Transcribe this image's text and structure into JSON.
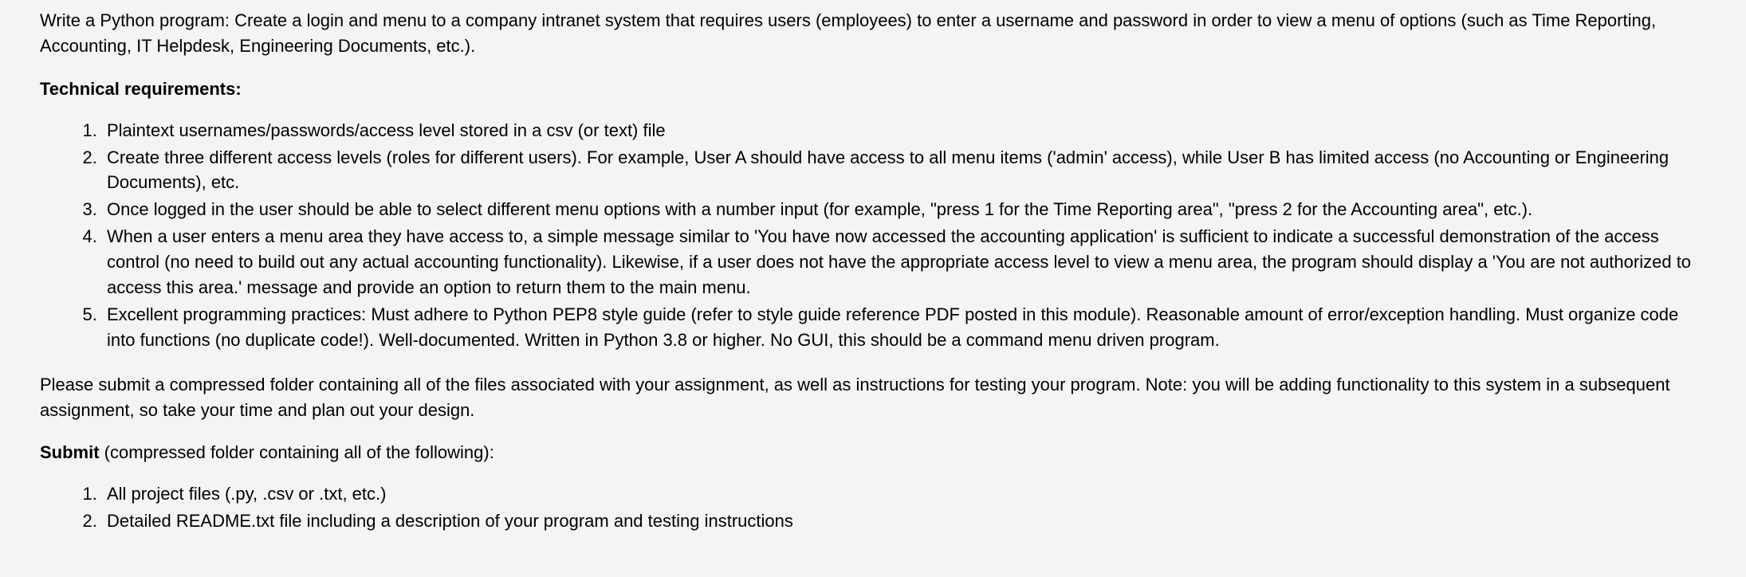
{
  "intro": "Write a Python program: Create a login and menu to a company intranet system that requires users (employees) to enter a username and password in order to view a menu of options (such as Time Reporting, Accounting, IT Helpdesk, Engineering Documents, etc.).",
  "technical_requirements_heading": "Technical requirements:",
  "technical_requirements": [
    "Plaintext usernames/passwords/access level stored in a csv (or text) file",
    "Create three different access levels (roles for different users). For example, User A should have access to all menu items ('admin' access), while User B has limited access (no Accounting or Engineering Documents), etc.",
    "Once logged in the user should be able to select different menu options with a number input (for example, \"press 1 for the Time Reporting area\", \"press 2 for the Accounting area\", etc.).",
    "When a user enters a menu area they have access to, a simple message similar to 'You have now accessed the accounting application' is sufficient to indicate a successful demonstration of the access control (no need to build out any actual accounting functionality). Likewise, if a user does not have the appropriate access level to view a menu area, the program should display a 'You are not authorized to access this area.' message and provide an option to return them to the main menu.",
    "Excellent programming practices: Must adhere to Python PEP8 style guide (refer to style guide reference PDF posted in this module). Reasonable amount of error/exception handling. Must organize code into functions (no duplicate code!). Well-documented. Written in Python 3.8 or higher. No GUI, this should be a command menu driven program."
  ],
  "submission_note": "Please submit a compressed folder containing all of the files associated with your assignment, as well as instructions for testing your program. Note: you will be adding functionality to this system in a subsequent assignment, so take your time and plan out your design.",
  "submit_heading_bold": "Submit",
  "submit_heading_rest": " (compressed folder containing all of the following):",
  "submit_items": [
    "All project files (.py, .csv or .txt, etc.)",
    "Detailed README.txt file including a description of your program and testing instructions"
  ]
}
